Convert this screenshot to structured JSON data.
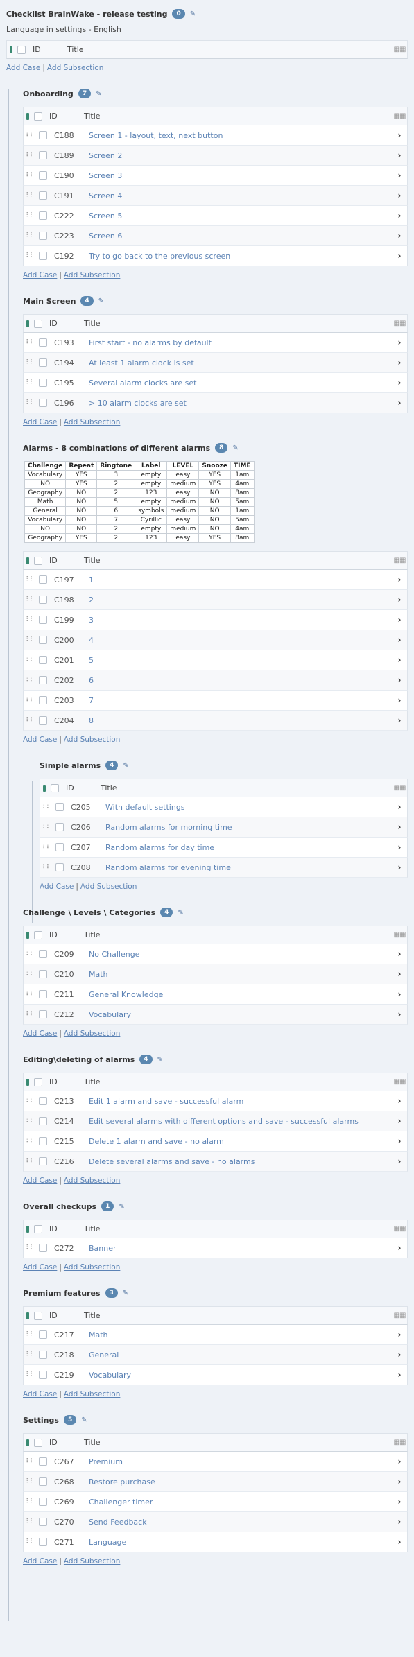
{
  "header": {
    "title": "Checklist BrainWake - release testing",
    "count": "0",
    "subtitle": "Language in settings - English"
  },
  "grid_headers": {
    "id": "ID",
    "title": "Title"
  },
  "links": {
    "add_case": "Add Case",
    "add_subsection": "Add Subsection",
    "separator": "|"
  },
  "sections": {
    "onboarding": {
      "title": "Onboarding",
      "count": "7",
      "rows": [
        {
          "id": "C188",
          "title": "Screen 1 - layout, text, next button"
        },
        {
          "id": "C189",
          "title": "Screen 2"
        },
        {
          "id": "C190",
          "title": "Screen 3"
        },
        {
          "id": "C191",
          "title": "Screen 4"
        },
        {
          "id": "C222",
          "title": "Screen 5"
        },
        {
          "id": "C223",
          "title": "Screen 6"
        },
        {
          "id": "C192",
          "title": "Try to go back to the previous screen"
        }
      ]
    },
    "main_screen": {
      "title": "Main Screen",
      "count": "4",
      "rows": [
        {
          "id": "C193",
          "title": "First start - no alarms by default"
        },
        {
          "id": "C194",
          "title": "At least 1 alarm clock is set"
        },
        {
          "id": "C195",
          "title": "Several alarm clocks are set"
        },
        {
          "id": "C196",
          "title": "> 10 alarm clocks are set"
        }
      ]
    },
    "alarms": {
      "title": "Alarms - 8 combinations of different alarms",
      "count": "8",
      "table_headers": [
        "Challenge",
        "Repeat",
        "Ringtone",
        "Label",
        "LEVEL",
        "Snooze",
        "TIME"
      ],
      "table_rows": [
        [
          "Vocabulary",
          "YES",
          "3",
          "empty",
          "easy",
          "YES",
          "1am"
        ],
        [
          "NO",
          "YES",
          "2",
          "empty",
          "medium",
          "YES",
          "4am"
        ],
        [
          "Geography",
          "NO",
          "2",
          "123",
          "easy",
          "NO",
          "8am"
        ],
        [
          "Math",
          "NO",
          "5",
          "empty",
          "medium",
          "NO",
          "5am"
        ],
        [
          "General",
          "NO",
          "6",
          "symbols",
          "medium",
          "NO",
          "1am"
        ],
        [
          "Vocabulary",
          "NO",
          "7",
          "Cyrillic",
          "easy",
          "NO",
          "5am"
        ],
        [
          "NO",
          "NO",
          "2",
          "empty",
          "medium",
          "NO",
          "4am"
        ],
        [
          "Geography",
          "YES",
          "2",
          "123",
          "easy",
          "YES",
          "8am"
        ]
      ],
      "rows": [
        {
          "id": "C197",
          "title": "1"
        },
        {
          "id": "C198",
          "title": "2"
        },
        {
          "id": "C199",
          "title": "3"
        },
        {
          "id": "C200",
          "title": "4"
        },
        {
          "id": "C201",
          "title": "5"
        },
        {
          "id": "C202",
          "title": "6"
        },
        {
          "id": "C203",
          "title": "7"
        },
        {
          "id": "C204",
          "title": "8"
        }
      ]
    },
    "simple_alarms": {
      "title": "Simple alarms",
      "count": "4",
      "rows": [
        {
          "id": "C205",
          "title": "With default settings"
        },
        {
          "id": "C206",
          "title": "Random alarms for morning time"
        },
        {
          "id": "C207",
          "title": "Random alarms for day time"
        },
        {
          "id": "C208",
          "title": "Random alarms for evening time"
        }
      ]
    },
    "challenge": {
      "title": "Challenge \\ Levels \\ Categories",
      "count": "4",
      "rows": [
        {
          "id": "C209",
          "title": "No Challenge"
        },
        {
          "id": "C210",
          "title": "Math"
        },
        {
          "id": "C211",
          "title": "General Knowledge"
        },
        {
          "id": "C212",
          "title": "Vocabulary"
        }
      ]
    },
    "editing": {
      "title": "Editing\\deleting of alarms",
      "count": "4",
      "rows": [
        {
          "id": "C213",
          "title": "Edit 1 alarm and save - successful alarm"
        },
        {
          "id": "C214",
          "title": "Edit several alarms with different options and save - successful alarms"
        },
        {
          "id": "C215",
          "title": "Delete 1 alarm and save - no alarm"
        },
        {
          "id": "C216",
          "title": "Delete several alarms and save - no alarms"
        }
      ]
    },
    "overall": {
      "title": "Overall checkups",
      "count": "1",
      "rows": [
        {
          "id": "C272",
          "title": "Banner"
        }
      ]
    },
    "premium": {
      "title": "Premium features",
      "count": "3",
      "rows": [
        {
          "id": "C217",
          "title": "Math"
        },
        {
          "id": "C218",
          "title": "General"
        },
        {
          "id": "C219",
          "title": "Vocabulary"
        }
      ]
    },
    "settings": {
      "title": "Settings",
      "count": "5",
      "rows": [
        {
          "id": "C267",
          "title": "Premium"
        },
        {
          "id": "C268",
          "title": "Restore purchase"
        },
        {
          "id": "C269",
          "title": "Challenger timer"
        },
        {
          "id": "C270",
          "title": "Send Feedback"
        },
        {
          "id": "C271",
          "title": "Language"
        }
      ]
    }
  }
}
